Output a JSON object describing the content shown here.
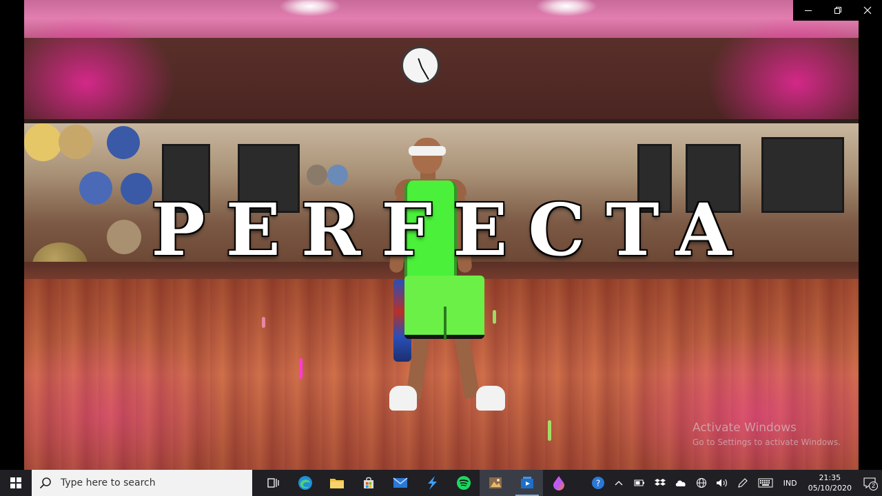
{
  "video": {
    "title_overlay": "PERFECTA"
  },
  "window_controls": {
    "minimize_icon": "minimize-icon",
    "maximize_icon": "restore-icon",
    "close_icon": "close-icon"
  },
  "watermark": {
    "line1": "Activate Windows",
    "line2": "Go to Settings to activate Windows."
  },
  "taskbar": {
    "search_placeholder": "Type here to search",
    "apps": [
      "task-view",
      "edge",
      "file-explorer",
      "microsoft-store",
      "mail",
      "visual-studio",
      "spotify",
      "photo-editor",
      "media-player",
      "color-app"
    ],
    "language": "IND",
    "time": "21:35",
    "date": "05/10/2020",
    "notification_count": "2"
  },
  "colors": {
    "taskbar_bg": "#1f1f24",
    "search_bg": "#f2f2f2",
    "active_indicator": "#7ab3e8"
  }
}
